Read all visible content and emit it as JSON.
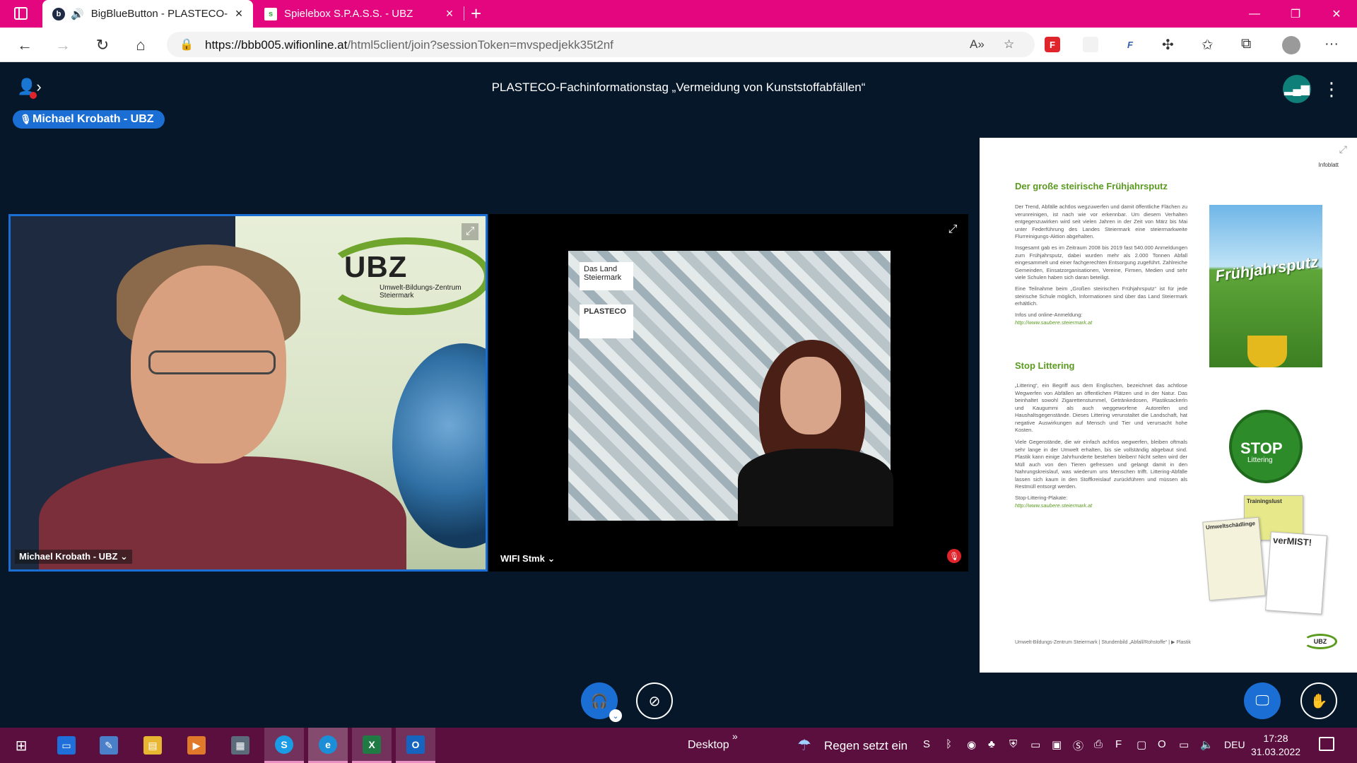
{
  "browser": {
    "tabs": [
      {
        "title": "BigBlueButton - PLASTECO-",
        "active": true,
        "favicon": "b",
        "audio": true
      },
      {
        "title": "Spielebox S.P.A.S.S. - UBZ",
        "active": false,
        "favicon": "s"
      }
    ],
    "url_host": "https://bbb005.wifionline.at",
    "url_path": "/html5client/join?sessionToken=mvspedjekk35t2nf",
    "extensions": [
      {
        "name": "flash-extension",
        "letter": "F",
        "color": "#e0242c"
      },
      {
        "name": "blank-extension",
        "letter": "",
        "color": "#f2f2f2"
      },
      {
        "name": "f-extension",
        "letter": "F",
        "color": "#2e5fa8"
      }
    ]
  },
  "meeting": {
    "title": "PLASTECO-Fachinformationstag „Vermeidung von Kunststoffabfällen“",
    "talking_indicator": "Michael Krobath - UBZ",
    "videos": [
      {
        "label": "Michael Krobath - UBZ ⌄",
        "banner_text": "UBZ",
        "banner_sub": "Umwelt-Bildungs-Zentrum Steiermark"
      },
      {
        "label": "WIFI Stmk ⌄",
        "logo_1": "Das Land Steiermark",
        "logo_2": "PLASTECO"
      }
    ]
  },
  "slide": {
    "kicker": "Infoblatt",
    "heading_1": "Der große steirische Frühjahrsputz",
    "para_1": "Der Trend, Abfälle achtlos wegzuwerfen und damit öffentliche Flächen zu verunreinigen, ist nach wie vor erkennbar. Um diesem Verhalten entgegenzuwirken wird seit vielen Jahren in der Zeit von März bis Mai unter Federführung des Landes Steiermark eine steiermarkweite Flurreinigungs-Aktion abgehalten.",
    "para_2": "Insgesamt gab es im Zeitraum 2008 bis 2019 fast 540.000 Anmeldungen zum Frühjahrsputz, dabei wurden mehr als 2.000 Tonnen Abfall eingesammelt und einer fachgerechten Entsorgung zugeführt. Zahlreiche Gemeinden, Einsatzorganisationen, Vereine, Firmen, Medien und sehr viele Schulen haben sich daran beteiligt.",
    "para_3": "Eine Teilnahme beim „Großen steirischen Frühjahrsputz“ ist für jede steirische Schule möglich, Informationen sind über das Land Steiermark erhältlich.",
    "label_1": "Infos und online-Anmeldung:",
    "link_1": "http://www.saubere.steiermark.at",
    "image_1_text": "Frühjahrsputz",
    "heading_2": "Stop Littering",
    "para_4": "„Littering“, ein Begriff aus dem Englischen, bezeichnet das achtlose Wegwerfen von Abfällen an öffentlichen Plätzen und in der Natur. Das beinhaltet sowohl Zigarettenstummel, Getränkedosen, Plastiksackerln und Kaugummi als auch weggeworfene Autoreifen und Haushaltsgegenstände. Dieses Littering verunstaltet die Landschaft, hat negative Auswirkungen auf Mensch und Tier und verursacht hohe Kosten.",
    "para_5": "Viele Gegenstände, die wir einfach achtlos wegwerfen, bleiben oftmals sehr lange in der Umwelt erhalten, bis sie vollständig abgebaut sind. Plastik kann einige Jahrhunderte bestehen bleiben! Nicht selten wird der Müll auch von den Tieren gefressen und gelangt damit in den Nahrungskreislauf, was wiederum uns Menschen trifft. Littering-Abfälle lassen sich kaum in den Stoffkreislauf zurückführen und müssen als Restmüll entsorgt werden.",
    "label_2": "Stop-Littering-Plakate:",
    "link_2": "http://www.saubere.steiermark.at",
    "stop_text": "STOP",
    "stop_sub": "Littering",
    "poster_1": "Trainingslust",
    "poster_2": "Umweltschädlinge",
    "poster_3": "verMIST!",
    "footer": "Umwelt-Bildungs-Zentrum Steiermark | Stundenbild „Abfall/Rohstoffe“ | ▶ Plastik",
    "logo": "UBZ"
  },
  "taskbar": {
    "desktop_label": "Desktop",
    "weather": "Regen setzt ein",
    "language": "DEU",
    "time": "17:28",
    "date": "31.03.2022",
    "apps": [
      {
        "name": "start-button",
        "glyph": "⊞",
        "color": ""
      },
      {
        "name": "taskbar-app-edu",
        "glyph": "▭",
        "color": "#1e6fd9"
      },
      {
        "name": "taskbar-app-paint",
        "glyph": "✎",
        "color": "#4a7fc9"
      },
      {
        "name": "taskbar-app-explorer",
        "glyph": "▤",
        "color": "#e8b630"
      },
      {
        "name": "taskbar-app-media",
        "glyph": "▶",
        "color": "#e07a2a"
      },
      {
        "name": "taskbar-app-calculator",
        "glyph": "▦",
        "color": "#5b6b7a"
      },
      {
        "name": "taskbar-app-skype",
        "glyph": "S",
        "color": "#1a9be6"
      },
      {
        "name": "taskbar-app-edge",
        "glyph": "e",
        "color": "#1a8fd8"
      },
      {
        "name": "taskbar-app-excel",
        "glyph": "X",
        "color": "#1f7a44"
      },
      {
        "name": "taskbar-app-outlook",
        "glyph": "O",
        "color": "#1565c0"
      }
    ]
  }
}
